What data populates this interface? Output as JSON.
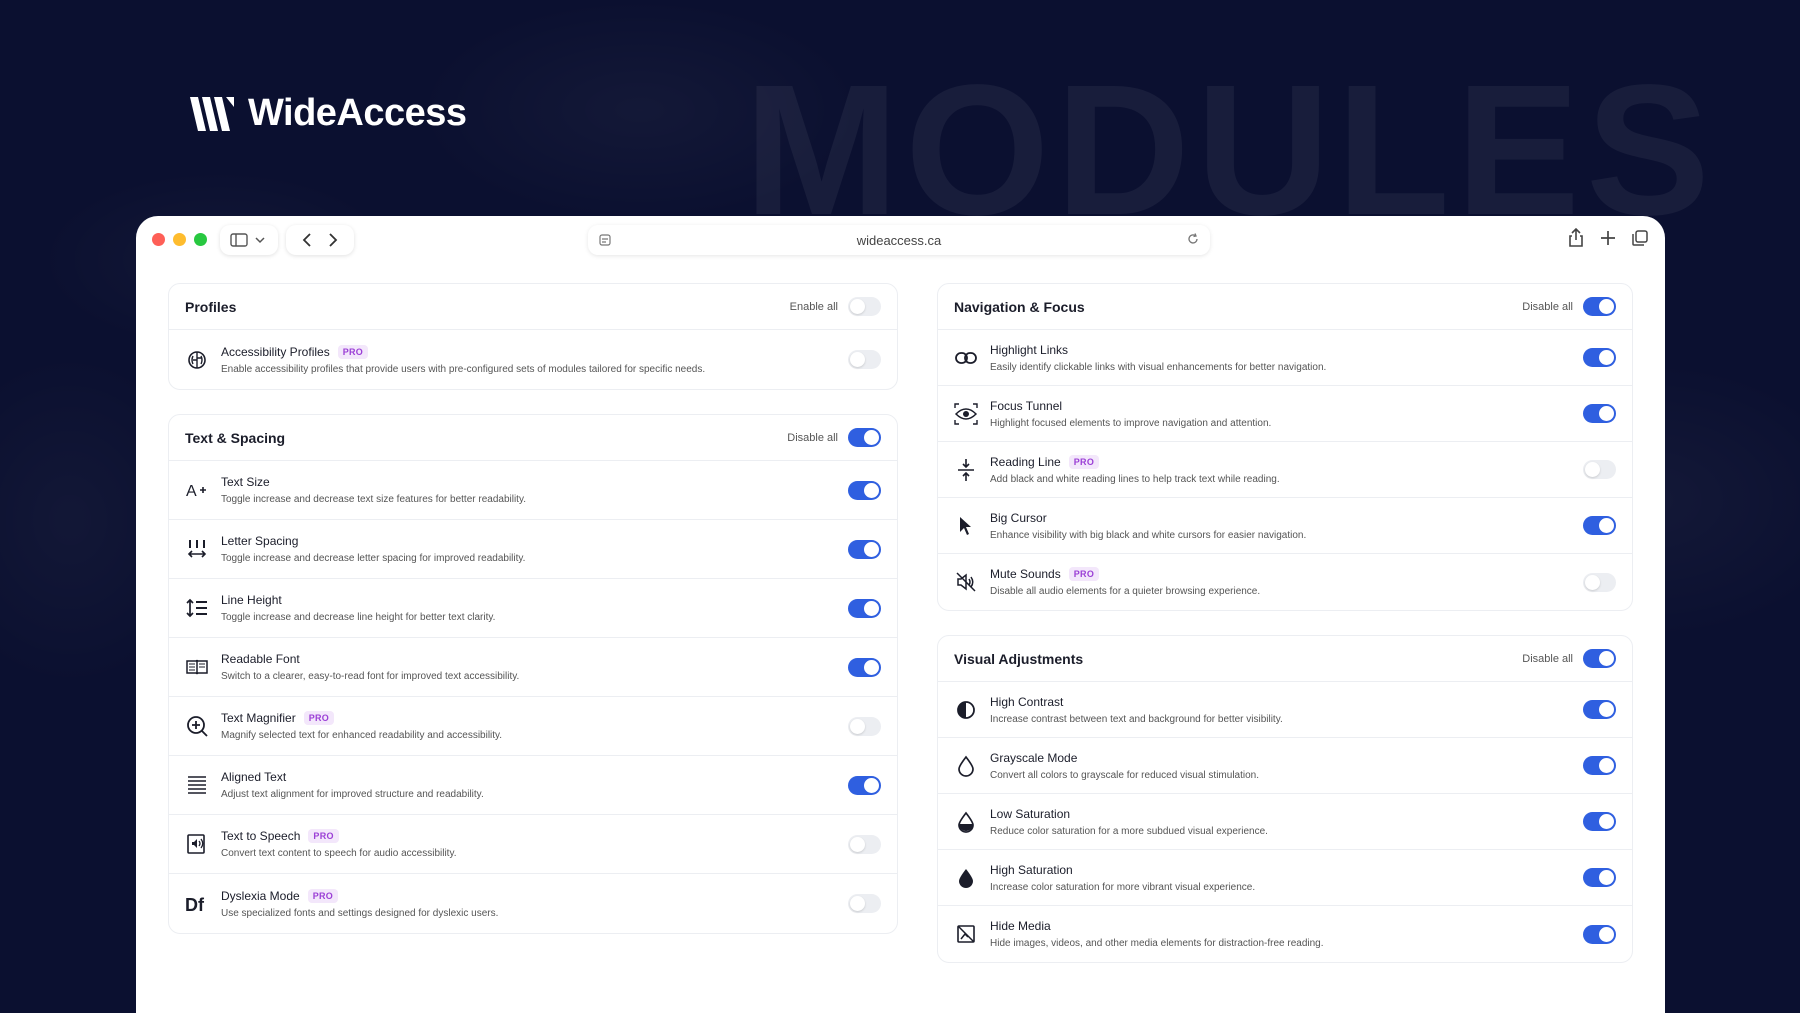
{
  "brand": {
    "name": "WideAccess"
  },
  "background_word": "MODULES",
  "browser": {
    "url": "wideaccess.ca"
  },
  "colors": {
    "accent": "#2f5fe0",
    "pro_text": "#9b3fd6",
    "pro_bg": "#f3e7fb",
    "background": "#0b1030"
  },
  "panels_left": [
    {
      "title": "Profiles",
      "action": "Enable all",
      "action_on": false,
      "items": [
        {
          "icon": "brain-icon",
          "title": "Accessibility Profiles",
          "pro": "PRO",
          "desc": "Enable accessibility profiles that provide users with pre-configured sets of modules tailored for specific needs.",
          "on": false
        }
      ]
    },
    {
      "title": "Text & Spacing",
      "action": "Disable all",
      "action_on": true,
      "items": [
        {
          "icon": "text-size-icon",
          "title": "Text Size",
          "pro": "",
          "desc": "Toggle increase and decrease text size features for better readability.",
          "on": true
        },
        {
          "icon": "letter-spacing-icon",
          "title": "Letter Spacing",
          "pro": "",
          "desc": "Toggle increase and decrease letter spacing for improved readability.",
          "on": true
        },
        {
          "icon": "line-height-icon",
          "title": "Line Height",
          "pro": "",
          "desc": "Toggle increase and decrease line height for better text clarity.",
          "on": true
        },
        {
          "icon": "book-icon",
          "title": "Readable Font",
          "pro": "",
          "desc": "Switch to a clearer, easy-to-read font for improved text accessibility.",
          "on": true
        },
        {
          "icon": "magnifier-icon",
          "title": "Text Magnifier",
          "pro": "PRO",
          "desc": "Magnify selected text for enhanced readability and accessibility.",
          "on": false
        },
        {
          "icon": "align-icon",
          "title": "Aligned Text",
          "pro": "",
          "desc": "Adjust text alignment for improved structure and readability.",
          "on": true
        },
        {
          "icon": "speech-icon",
          "title": "Text to Speech",
          "pro": "PRO",
          "desc": "Convert text content to speech for audio accessibility.",
          "on": false
        },
        {
          "icon": "dyslexia-icon",
          "title": "Dyslexia Mode",
          "pro": "PRO",
          "desc": "Use specialized fonts and settings designed for dyslexic users.",
          "on": false
        }
      ]
    }
  ],
  "panels_right": [
    {
      "title": "Navigation & Focus",
      "action": "Disable all",
      "action_on": true,
      "items": [
        {
          "icon": "link-icon",
          "title": "Highlight Links",
          "pro": "",
          "desc": "Easily identify clickable links with visual enhancements for better navigation.",
          "on": true
        },
        {
          "icon": "eye-icon",
          "title": "Focus Tunnel",
          "pro": "",
          "desc": "Highlight focused elements to improve navigation and attention.",
          "on": true
        },
        {
          "icon": "reading-line-icon",
          "title": "Reading Line",
          "pro": "PRO",
          "desc": "Add black and white reading lines to help track text while reading.",
          "on": false
        },
        {
          "icon": "cursor-icon",
          "title": "Big Cursor",
          "pro": "",
          "desc": "Enhance visibility with big black and white cursors for easier navigation.",
          "on": true
        },
        {
          "icon": "mute-icon",
          "title": "Mute Sounds",
          "pro": "PRO",
          "desc": "Disable all audio elements for a quieter browsing experience.",
          "on": false
        }
      ]
    },
    {
      "title": "Visual Adjustments",
      "action": "Disable all",
      "action_on": true,
      "items": [
        {
          "icon": "contrast-icon",
          "title": "High Contrast",
          "pro": "",
          "desc": "Increase contrast between text and background for better visibility.",
          "on": true
        },
        {
          "icon": "drop-outline-icon",
          "title": "Grayscale Mode",
          "pro": "",
          "desc": "Convert all colors to grayscale for reduced visual stimulation.",
          "on": true
        },
        {
          "icon": "drop-half-icon",
          "title": "Low Saturation",
          "pro": "",
          "desc": "Reduce color saturation for a more subdued visual experience.",
          "on": true
        },
        {
          "icon": "drop-filled-icon",
          "title": "High Saturation",
          "pro": "",
          "desc": "Increase color saturation for more vibrant visual experience.",
          "on": true
        },
        {
          "icon": "hide-media-icon",
          "title": "Hide Media",
          "pro": "",
          "desc": "Hide images, videos, and other media elements for distraction-free reading.",
          "on": true
        }
      ]
    }
  ]
}
